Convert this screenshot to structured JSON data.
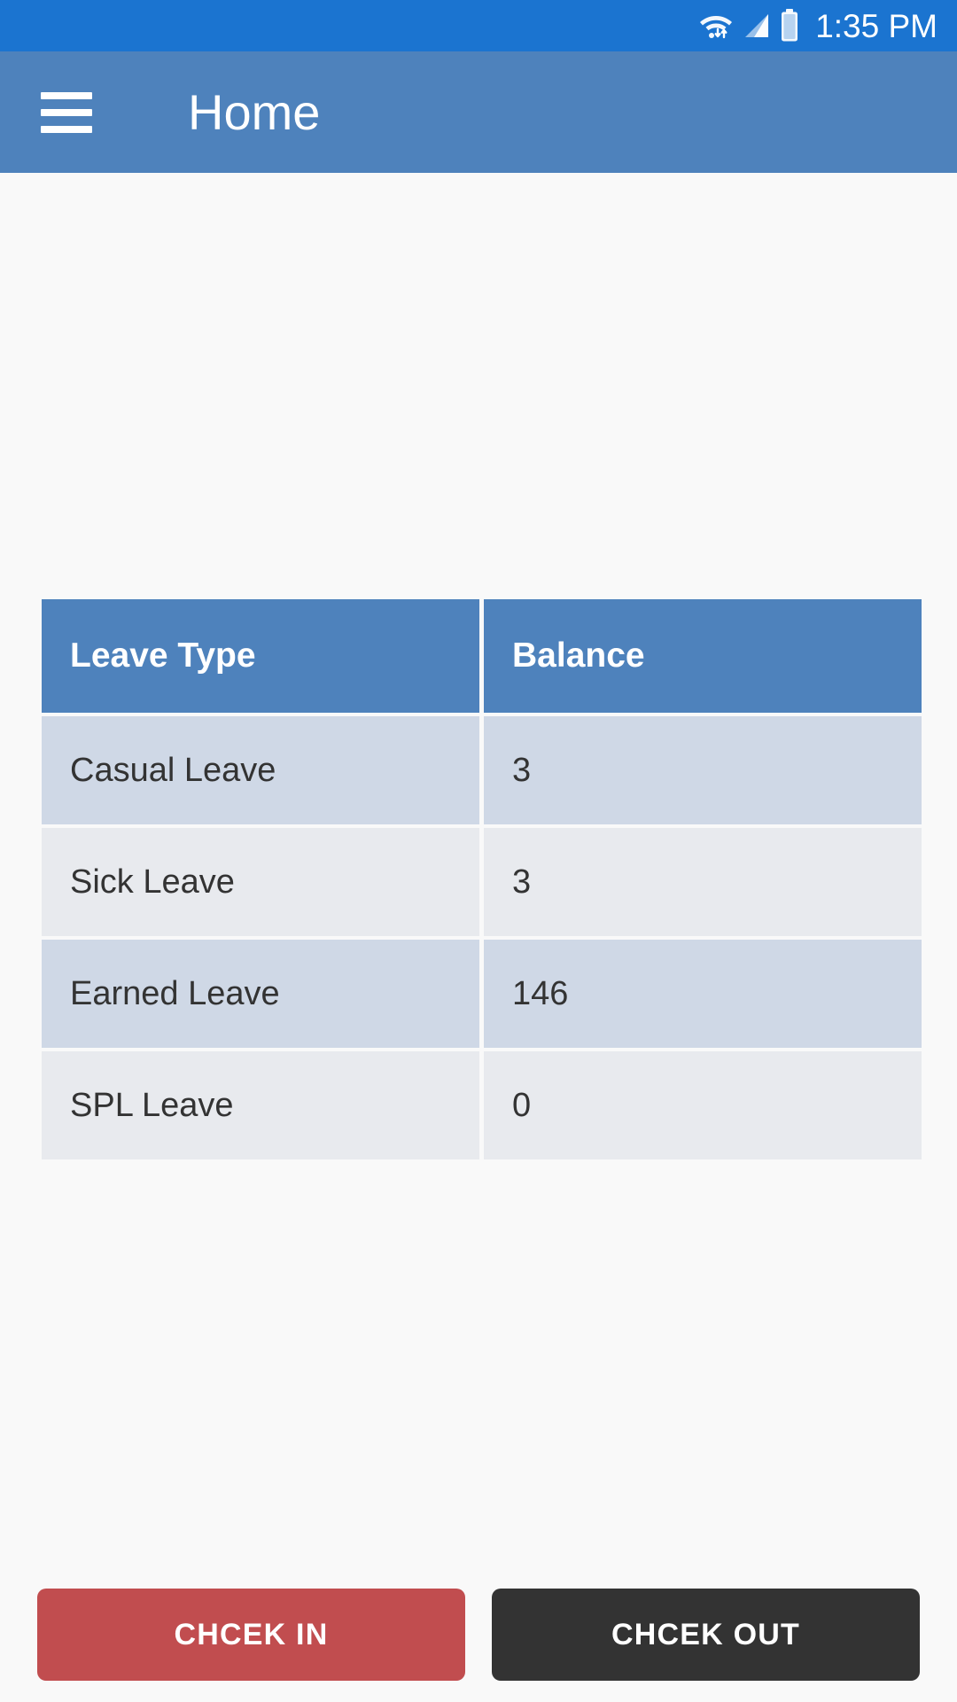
{
  "status_bar": {
    "time": "1:35 PM",
    "background_color": "#1B74D0",
    "icons": [
      "wifi-icon",
      "cellular-signal-icon",
      "battery-icon"
    ]
  },
  "app_bar": {
    "title": "Home",
    "menu_icon": "hamburger-menu-icon",
    "background_color": "#4E82BC"
  },
  "leave_table": {
    "columns": [
      "Leave Type",
      "Balance"
    ],
    "header_color": "#4E82BC",
    "row_odd_color": "#CFD8E6",
    "row_even_color": "#E8EAEE",
    "rows": [
      {
        "type": "Casual Leave",
        "balance": "3"
      },
      {
        "type": "Sick Leave",
        "balance": "3"
      },
      {
        "type": "Earned Leave",
        "balance": "146"
      },
      {
        "type": "SPL Leave",
        "balance": "0"
      }
    ]
  },
  "actions": {
    "check_in_label": "CHCEK IN",
    "check_out_label": "CHCEK OUT",
    "check_in_color": "#C14D4F",
    "check_out_color": "#333333"
  }
}
